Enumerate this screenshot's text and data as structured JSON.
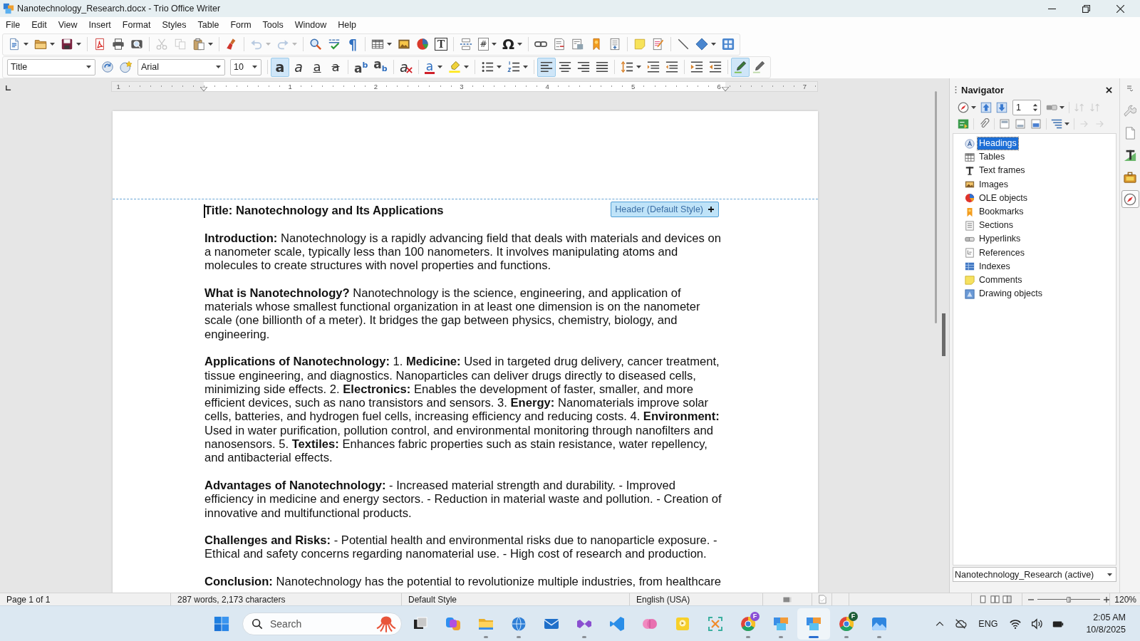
{
  "window": {
    "title": "Nanotechnology_Research.docx - Trio Office Writer"
  },
  "menu": [
    "File",
    "Edit",
    "View",
    "Insert",
    "Format",
    "Styles",
    "Table",
    "Form",
    "Tools",
    "Window",
    "Help"
  ],
  "standard_toolbar": [
    {
      "disabled": false
    },
    {
      "disabled": false
    },
    {
      "disabled": false
    },
    {
      "disabled": false
    },
    {
      "disabled": false
    },
    {
      "disabled": false
    },
    {
      "disabled": true
    },
    {
      "disabled": true
    },
    {
      "disabled": false
    },
    {
      "disabled": false
    },
    {
      "disabled": true
    },
    {
      "disabled": true
    },
    {
      "disabled": false
    },
    {
      "disabled": false
    },
    {
      "glyph": "¶",
      "disabled": false
    },
    {
      "disabled": false
    },
    {
      "disabled": false
    },
    {
      "disabled": false
    },
    {
      "glyph": "T",
      "disabled": false
    },
    {
      "disabled": false
    },
    {
      "glyph": "#",
      "disabled": false
    },
    {
      "glyph": "Ω",
      "disabled": false
    },
    {
      "disabled": false
    },
    {
      "disabled": false
    },
    {
      "disabled": false
    },
    {
      "disabled": false
    },
    {
      "disabled": false
    },
    {
      "disabled": false
    },
    {
      "disabled": false
    },
    {
      "disabled": false
    },
    {
      "disabled": false
    },
    {
      "disabled": false
    }
  ],
  "formatting_toolbar": {
    "paragraph_style": "Title",
    "font_name": "Arial",
    "font_size": "10",
    "buttons": [
      {
        "selected": false
      },
      {
        "selected": false
      },
      {
        "glyph": "a",
        "selected": true
      },
      {
        "glyph": "a",
        "selected": false
      },
      {
        "glyph": "a",
        "selected": false
      },
      {
        "glyph": "a",
        "selected": false
      },
      {
        "glyph": "a$^{b}$",
        "selected": false
      },
      {
        "glyph": "a$_{b}$",
        "selected": false
      },
      {
        "glyph": "a",
        "selected": false
      },
      {
        "glyph": "a",
        "selected": false
      },
      {
        "selected": false
      },
      {
        "selected": false
      },
      {
        "selected": false
      },
      {
        "selected": true
      },
      {
        "selected": false
      },
      {
        "selected": false
      },
      {
        "selected": false
      },
      {
        "selected": false
      },
      {
        "selected": false
      },
      {
        "selected": false
      },
      {
        "selected": false
      },
      {
        "selected": false
      },
      {
        "selected": true
      },
      {
        "selected": false
      }
    ]
  },
  "ruler": {
    "labels": [
      "1",
      "1",
      "2",
      "3",
      "4",
      "5",
      "6",
      "7"
    ]
  },
  "document": {
    "header_label": "Header (Default Style)",
    "paragraphs": [
      {
        "kind": "title",
        "text": "Title: Nanotechnology and Its Applications"
      },
      {
        "kind": "body",
        "text": "**Introduction:** Nanotechnology is a rapidly advancing field that deals with materials and devices on a nanometer scale, typically less than 100 nanometers. It involves manipulating atoms and molecules to create structures with novel properties and functions."
      },
      {
        "kind": "body",
        "text": "**What is Nanotechnology?** Nanotechnology is the science, engineering, and application of materials whose smallest functional organization in at least one dimension is on the nanometer scale (one billionth of a meter). It bridges the gap between physics, chemistry, biology, and engineering."
      },
      {
        "kind": "body",
        "text": "**Applications of Nanotechnology:** 1. **Medicine:** Used in targeted drug delivery, cancer treatment, tissue engineering, and diagnostics. Nanoparticles can deliver drugs directly to diseased cells, minimizing side effects. 2. **Electronics:** Enables the development of faster, smaller, and more efficient devices, such as nano transistors and sensors. 3. **Energy:** Nanomaterials improve solar cells, batteries, and hydrogen fuel cells, increasing efficiency and reducing costs. 4. **Environment:** Used in water purification, pollution control, and environmental monitoring through nanofilters and nanosensors. 5. **Textiles:** Enhances fabric properties such as stain resistance, water repellency, and antibacterial effects."
      },
      {
        "kind": "body",
        "text": "**Advantages of Nanotechnology:** - Increased material strength and durability. - Improved efficiency in medicine and energy sectors. - Reduction in material waste and pollution. - Creation of innovative and multifunctional products."
      },
      {
        "kind": "body",
        "text": "**Challenges and Risks:** - Potential health and environmental risks due to nanoparticle exposure. - Ethical and safety concerns regarding nanomaterial use. - High cost of research and production."
      },
      {
        "kind": "body",
        "text": "**Conclusion:** Nanotechnology has the potential to revolutionize multiple industries, from healthcare"
      }
    ]
  },
  "navigator": {
    "title": "Navigator",
    "page": "1",
    "tools": [
      {
        "disabled": false
      },
      {
        "disabled": false
      },
      {
        "disabled": false
      },
      {
        "disabled": false
      },
      {
        "disabled": true
      },
      {
        "disabled": true
      },
      {
        "disabled": false
      },
      {
        "disabled": false
      },
      {
        "disabled": false
      },
      {
        "disabled": false
      },
      {
        "disabled": false
      },
      {
        "disabled": false
      },
      {
        "disabled": true
      },
      {
        "disabled": true
      }
    ],
    "categories": [
      {
        "label": "Headings",
        "selected": true
      },
      {
        "label": "Tables",
        "selected": false
      },
      {
        "label": "Text frames",
        "selected": false
      },
      {
        "label": "Images",
        "selected": false
      },
      {
        "label": "OLE objects",
        "selected": false
      },
      {
        "label": "Bookmarks",
        "selected": false
      },
      {
        "label": "Sections",
        "selected": false
      },
      {
        "label": "Hyperlinks",
        "selected": false
      },
      {
        "label": "References",
        "selected": false
      },
      {
        "label": "Indexes",
        "selected": false
      },
      {
        "label": "Comments",
        "selected": false
      },
      {
        "label": "Drawing objects",
        "selected": false
      }
    ],
    "document_selector": "Nanotechnology_Research (active)"
  },
  "deck_tabs": [
    {
      "selected": false
    },
    {
      "selected": false
    },
    {
      "selected": false
    },
    {
      "selected": false
    },
    {
      "selected": true
    }
  ],
  "status_bar": {
    "page": "Page 1 of 1",
    "word_count": "287 words, 2,173 characters",
    "page_style": "Default Style",
    "language": "English (USA)",
    "zoom_slider": {
      "level": 0.5
    },
    "zoom": "120%"
  },
  "taskbar": {
    "search": {
      "placeholder": "Search"
    },
    "apps": [
      {
        "running": false,
        "selected": false
      },
      {
        "running": false,
        "selected": false
      },
      {
        "running": true,
        "selected": false
      },
      {
        "running": true,
        "selected": false
      },
      {
        "running": false,
        "selected": false
      },
      {
        "running": true,
        "selected": false
      },
      {
        "running": false,
        "selected": false
      },
      {
        "running": false,
        "selected": false
      },
      {
        "running": false,
        "selected": false
      },
      {
        "running": false,
        "selected": false
      },
      {
        "running": true,
        "selected": false,
        "badge": {
          "text": "F",
          "color": "#8a4fd6"
        }
      },
      {
        "running": true,
        "selected": false
      },
      {
        "running": true,
        "selected": true
      },
      {
        "running": true,
        "selected": false,
        "badge": {
          "text": "F",
          "color": "#1e5e38"
        }
      },
      {
        "running": true,
        "selected": false
      }
    ],
    "tray": {
      "language": "ENG",
      "time": "2:05 AM",
      "date": "10/8/2025"
    }
  }
}
